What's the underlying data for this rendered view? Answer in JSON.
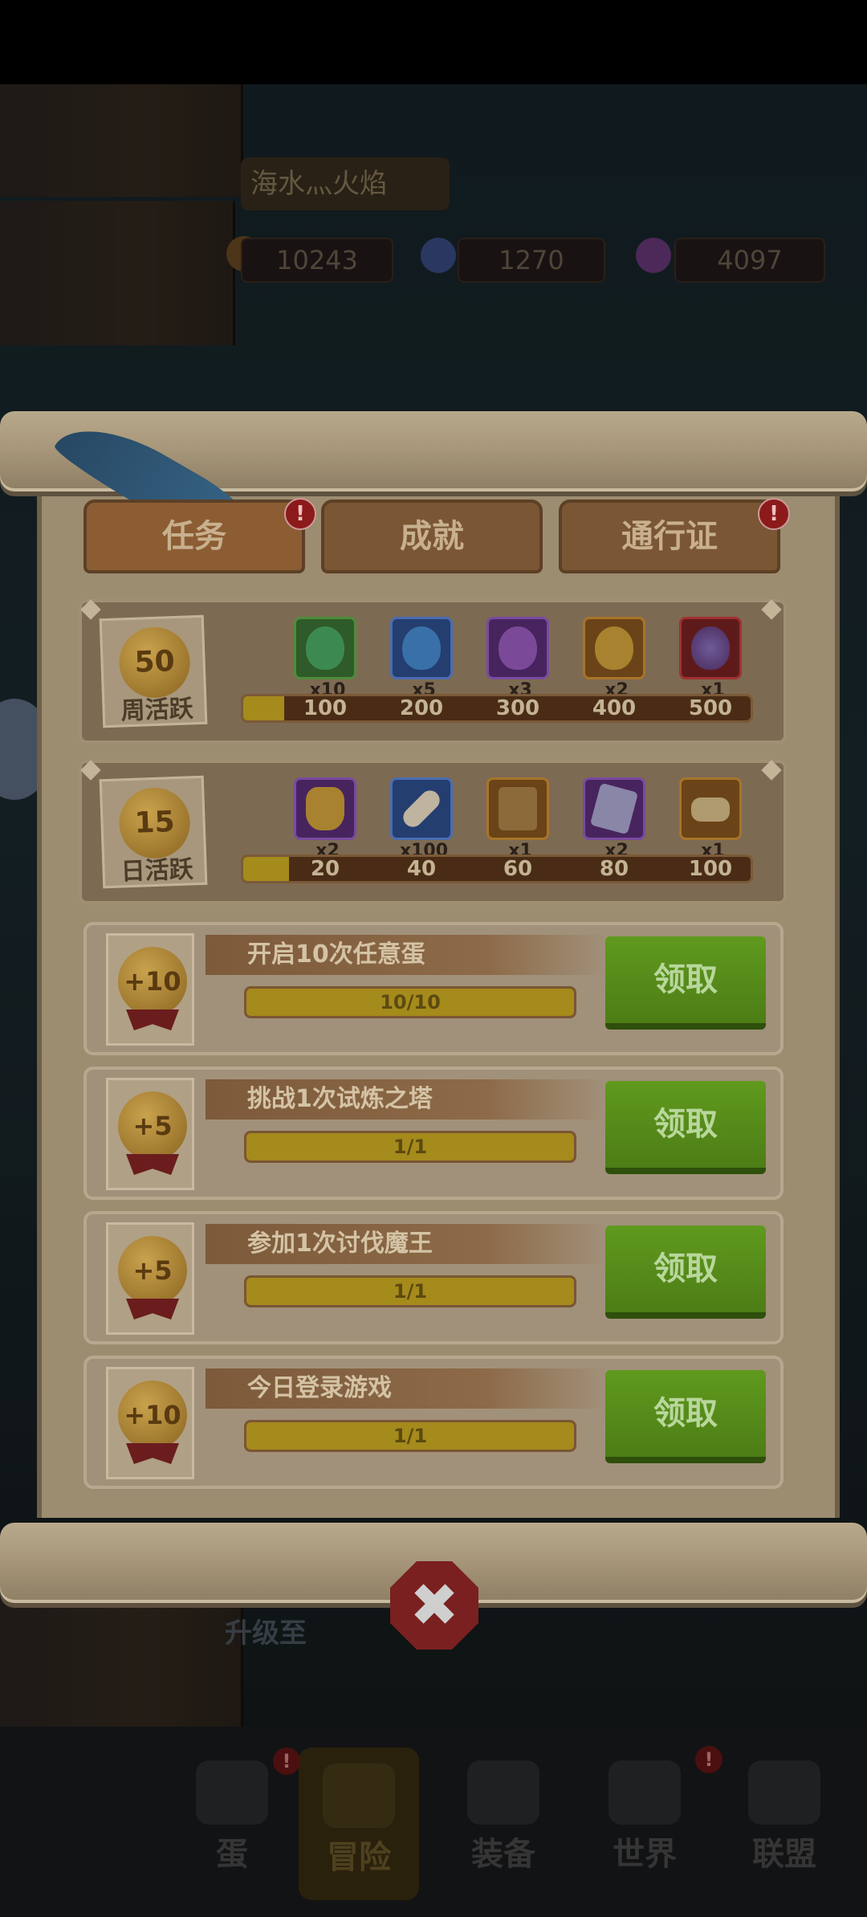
{
  "background": {
    "player_name": "海水灬火焰",
    "resources": [
      {
        "name": "gold",
        "value": "10243",
        "icon": "gold-coin-icon",
        "color": "#8a6a2a"
      },
      {
        "name": "crystal",
        "value": "1270",
        "icon": "blue-crystal-icon",
        "color": "#3b4d87"
      },
      {
        "name": "gem",
        "value": "4097",
        "icon": "purple-gem-icon",
        "color": "#6a3a7a"
      }
    ],
    "hint_text": "升级至",
    "bottom_nav": [
      {
        "label": "蛋",
        "icon": "egg-icon"
      },
      {
        "label": "冒险",
        "icon": "crossed-swords-icon"
      },
      {
        "label": "装备",
        "icon": "book-icon"
      },
      {
        "label": "世界",
        "icon": "map-icon"
      },
      {
        "label": "联盟",
        "icon": "lock-icon"
      }
    ],
    "active_nav": 1
  },
  "tabs": [
    {
      "label": "任务",
      "alert": "!"
    },
    {
      "label": "成就",
      "alert": ""
    },
    {
      "label": "通行证",
      "alert": "!"
    }
  ],
  "weekly": {
    "points": "50",
    "label": "周活跃",
    "progress_fraction": 0.08,
    "milestones": [
      "100",
      "200",
      "300",
      "400",
      "500"
    ],
    "rewards": [
      {
        "qty": "x10",
        "icon": "green-egg-icon",
        "color": "#3a7a3a"
      },
      {
        "qty": "x5",
        "icon": "blue-egg-icon",
        "color": "#2e4f8e"
      },
      {
        "qty": "x3",
        "icon": "purple-egg-icon",
        "color": "#5a2a7a"
      },
      {
        "qty": "x2",
        "icon": "golden-egg-icon",
        "color": "#8a5a1a"
      },
      {
        "qty": "x1",
        "icon": "red-orb-egg-icon",
        "color": "#7a1a1a"
      }
    ]
  },
  "daily": {
    "points": "15",
    "label": "日活跃",
    "progress_fraction": 0.09,
    "milestones": [
      "20",
      "40",
      "60",
      "80",
      "100"
    ],
    "rewards": [
      {
        "qty": "x2",
        "icon": "treasure-sack-icon",
        "color": "#5a2a7a"
      },
      {
        "qty": "x100",
        "icon": "bone-icon",
        "color": "#2e4f8e"
      },
      {
        "qty": "x1",
        "icon": "chest-icon",
        "color": "#8a5a1a"
      },
      {
        "qty": "x2",
        "icon": "crystal-cube-icon",
        "color": "#5a2a7a"
      },
      {
        "qty": "x1",
        "icon": "scroll-icon",
        "color": "#8a5a1a"
      }
    ]
  },
  "tasks": [
    {
      "points": "+10",
      "title": "开启10次任意蛋",
      "progress": "10/10",
      "fraction": 1.0,
      "button": "领取"
    },
    {
      "points": "+5",
      "title": "挑战1次试炼之塔",
      "progress": "1/1",
      "fraction": 1.0,
      "button": "领取"
    },
    {
      "points": "+5",
      "title": "参加1次讨伐魔王",
      "progress": "1/1",
      "fraction": 1.0,
      "button": "领取"
    },
    {
      "points": "+10",
      "title": "今日登录游戏",
      "progress": "1/1",
      "fraction": 1.0,
      "button": "领取"
    }
  ],
  "close_glyph": "✖"
}
